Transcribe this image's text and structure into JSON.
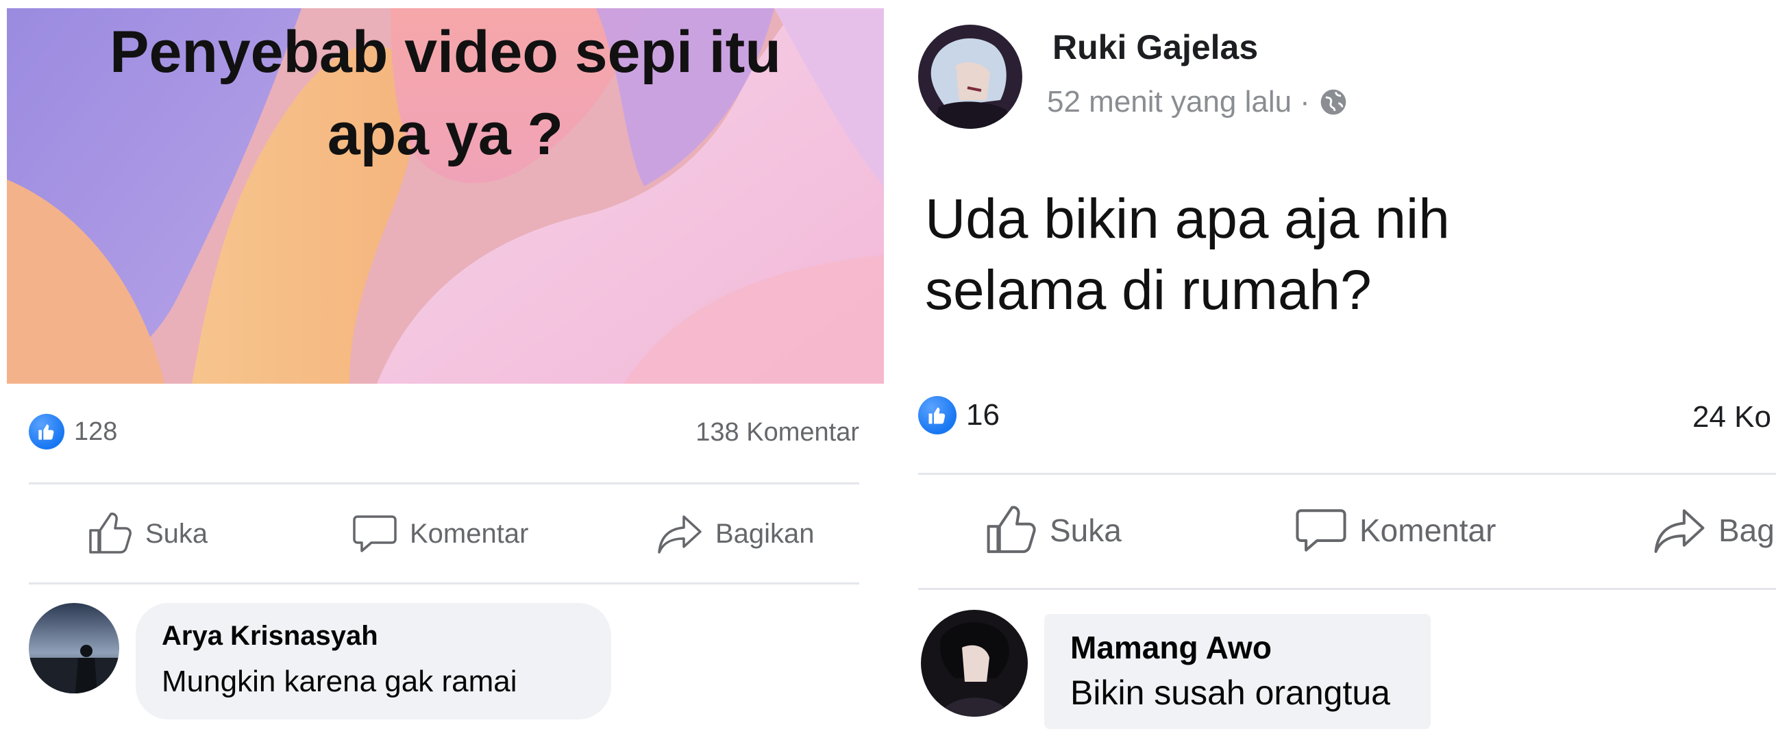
{
  "left_post": {
    "image_caption": "Penyebab video sepi itu\napa ya ?",
    "reactions": "128",
    "comments": "138 Komentar",
    "actions": {
      "like": "Suka",
      "comment": "Komentar",
      "share": "Bagikan"
    },
    "comment": {
      "author": "Arya Krisnasyah",
      "text": "Mungkin karena gak ramai"
    }
  },
  "right_post": {
    "author": "Ruki Gajelas",
    "time": "52 menit yang lalu",
    "separator": "·",
    "text": "Uda bikin apa aja nih\nselama di rumah?",
    "reactions": "16",
    "comments": "24 Ko",
    "actions": {
      "like": "Suka",
      "comment": "Komentar",
      "share": "Bag"
    },
    "comment": {
      "author": "Mamang Awo",
      "text": "Bikin susah orangtua"
    }
  },
  "colors": {
    "like_blue": "#1877f2",
    "meta_gray": "#65676b",
    "bubble": "#f0f2f5"
  },
  "icons": [
    "like-badge-icon",
    "thumbs-up-icon",
    "speech-bubble-icon",
    "share-arrow-icon",
    "globe-icon"
  ]
}
